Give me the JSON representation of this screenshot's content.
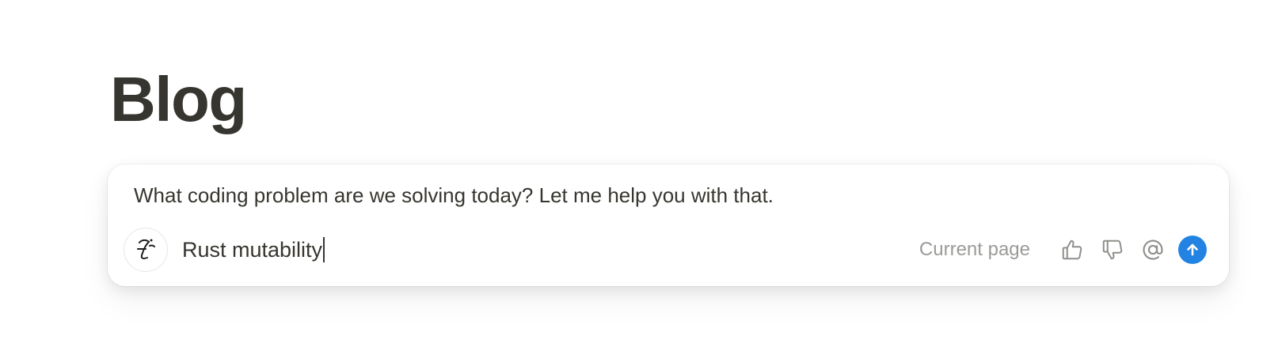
{
  "page": {
    "title": "Blog"
  },
  "ai_panel": {
    "message": "What coding problem are we solving today? Let me help you with that.",
    "avatar_icon": "ai-face-icon",
    "input": {
      "value": "Rust mutability"
    },
    "context_label": "Current page",
    "actions": [
      {
        "icon": "thumbs-up-icon"
      },
      {
        "icon": "thumbs-down-icon"
      },
      {
        "icon": "at-mention-icon"
      },
      {
        "icon": "send-arrow-icon"
      }
    ],
    "accent_color": "#2383e2"
  }
}
